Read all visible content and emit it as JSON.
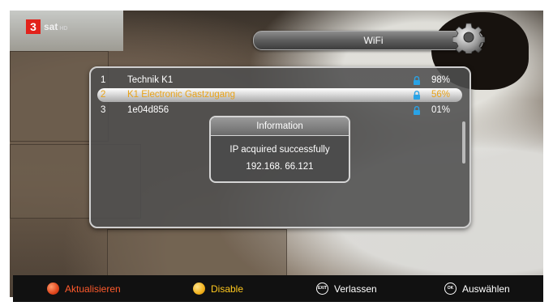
{
  "channel": {
    "logo_number": "3",
    "logo_text": "sat",
    "logo_hd": "HD"
  },
  "header": {
    "title": "WiFi"
  },
  "networks": [
    {
      "index": "1",
      "name": "Technik K1",
      "signal": "98%",
      "locked": true,
      "selected": false
    },
    {
      "index": "2",
      "name": "K1 Electronic Gastzugang",
      "signal": "56%",
      "locked": true,
      "selected": true
    },
    {
      "index": "3",
      "name": "1e04d856",
      "signal": "01%",
      "locked": true,
      "selected": false
    }
  ],
  "dialog": {
    "title": "Information",
    "message": "IP acquired successfully",
    "ip": "192.168. 66.121"
  },
  "footer": {
    "red": {
      "label": "Aktualisieren",
      "color": "#ff5a2c"
    },
    "yellow": {
      "label": "Disable",
      "color": "#ffc81e"
    },
    "exit": {
      "label": "Verlassen",
      "key_label": "EXIT"
    },
    "ok": {
      "label": "Auswählen",
      "key_label": "OK"
    }
  },
  "colors": {
    "lock_icon": "#29a3e6",
    "selected_text": "#e8a31a"
  }
}
